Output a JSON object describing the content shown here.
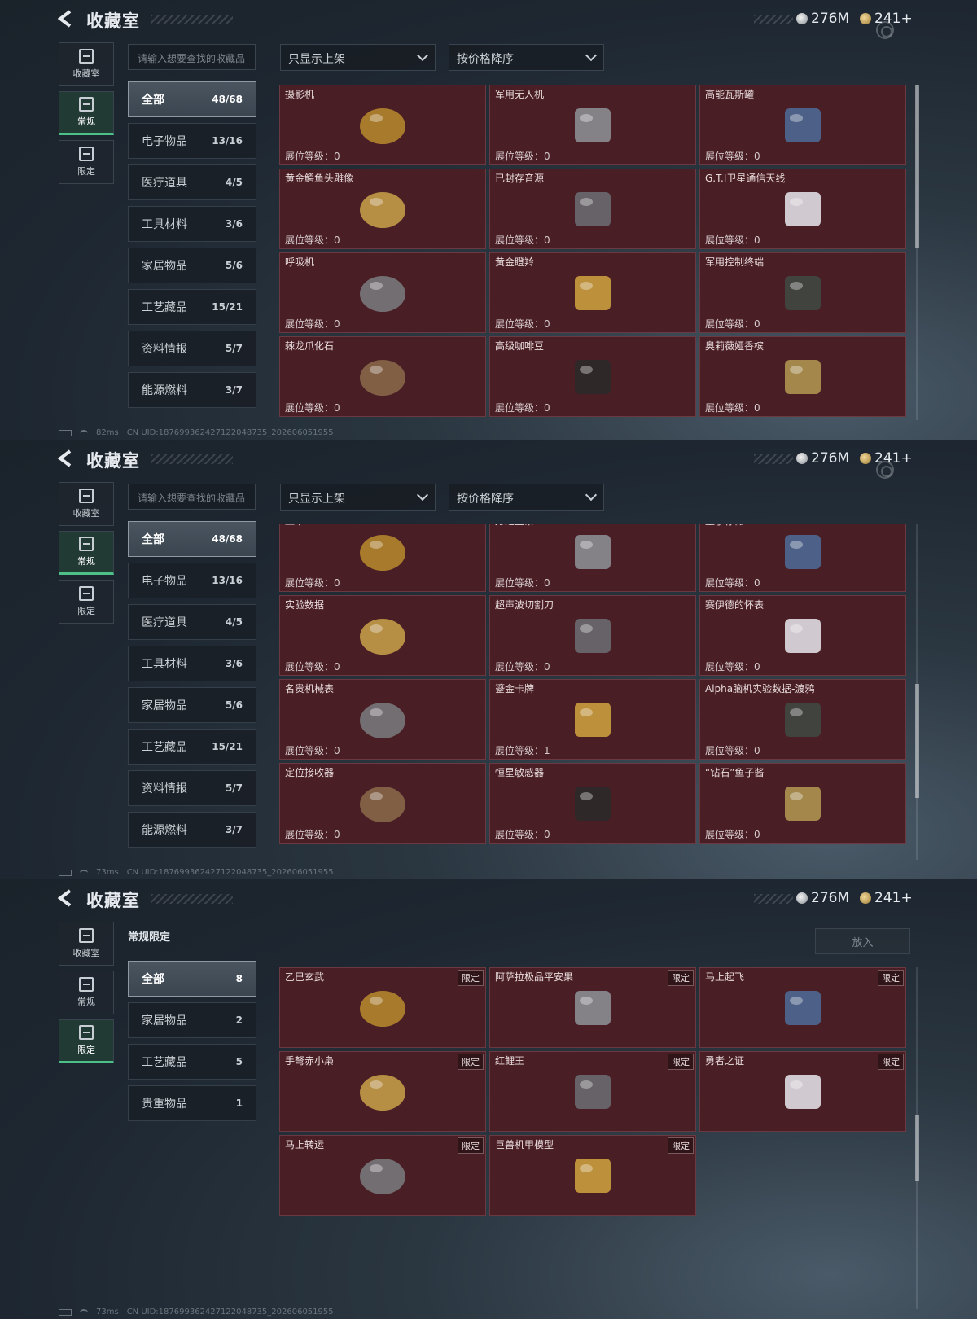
{
  "header": {
    "title": "收藏室",
    "silver": "276M",
    "gold": "241",
    "gold_plus": "+"
  },
  "left_nav": {
    "collection": "收藏室",
    "regular": "常规",
    "limited": "限定"
  },
  "search_placeholder": "请输入想要查找的收藏品",
  "filters": {
    "show": "只显示上架",
    "sort": "按价格降序"
  },
  "regular_categories": [
    {
      "label": "全部",
      "count": "48/68"
    },
    {
      "label": "电子物品",
      "count": "13/16"
    },
    {
      "label": "医疗道具",
      "count": "4/5"
    },
    {
      "label": "工具材料",
      "count": "3/6"
    },
    {
      "label": "家居物品",
      "count": "5/6"
    },
    {
      "label": "工艺藏品",
      "count": "15/21"
    },
    {
      "label": "资料情报",
      "count": "5/7"
    },
    {
      "label": "能源燃料",
      "count": "3/7"
    }
  ],
  "level_prefix": "展位等级：",
  "panel1_items": [
    {
      "name": "摄影机",
      "level": "0"
    },
    {
      "name": "军用无人机",
      "level": "0"
    },
    {
      "name": "高能瓦斯罐",
      "level": "0"
    },
    {
      "name": "黄金鳄鱼头雕像",
      "level": "0"
    },
    {
      "name": "已封存音源",
      "level": "0"
    },
    {
      "name": "G.T.I卫星通信天线",
      "level": "0"
    },
    {
      "name": "呼吸机",
      "level": "0"
    },
    {
      "name": "黄金瞪羚",
      "level": "0"
    },
    {
      "name": "军用控制终端",
      "level": "0"
    },
    {
      "name": "棘龙爪化石",
      "level": "0"
    },
    {
      "name": "高级咖啡豆",
      "level": "0"
    },
    {
      "name": "奥莉薇娅香槟",
      "level": "0"
    }
  ],
  "panel2_items": [
    {
      "name": "显卡",
      "level": "0"
    },
    {
      "name": "万足金条",
      "level": "0"
    },
    {
      "name": "量子存储",
      "level": "0"
    },
    {
      "name": "实验数据",
      "level": "0"
    },
    {
      "name": "超声波切割刀",
      "level": "0"
    },
    {
      "name": "赛伊德的怀表",
      "level": "0"
    },
    {
      "name": "名贵机械表",
      "level": "0"
    },
    {
      "name": "鎏金卡牌",
      "level": "1"
    },
    {
      "name": "Alpha脑机实验数据-渡鸦",
      "level": "0"
    },
    {
      "name": "定位接收器",
      "level": "0"
    },
    {
      "name": "恒星敏感器",
      "level": "0"
    },
    {
      "name": "“钻石”鱼子酱",
      "level": "0"
    }
  ],
  "limited": {
    "subtitle": "常规限定",
    "put_button": "放入",
    "tag": "限定",
    "categories": [
      {
        "label": "全部",
        "count": "8"
      },
      {
        "label": "家居物品",
        "count": "2"
      },
      {
        "label": "工艺藏品",
        "count": "5"
      },
      {
        "label": "贵重物品",
        "count": "1"
      }
    ],
    "items": [
      {
        "name": "乙巳玄武"
      },
      {
        "name": "阿萨拉极品平安果"
      },
      {
        "name": "马上起飞"
      },
      {
        "name": "手弩赤小枭"
      },
      {
        "name": "红鲤王"
      },
      {
        "name": "勇者之证"
      },
      {
        "name": "马上转运"
      },
      {
        "name": "巨兽机甲模型"
      }
    ]
  },
  "footers": [
    {
      "ping": "82ms",
      "uid": "CN UID:18769936242712204873​5_202606051955"
    },
    {
      "ping": "73ms",
      "uid": "CN UID:187699362427122048735_202606051955"
    },
    {
      "ping": "73ms",
      "uid": "CN UID:187699362427122048735_202606051955"
    }
  ]
}
